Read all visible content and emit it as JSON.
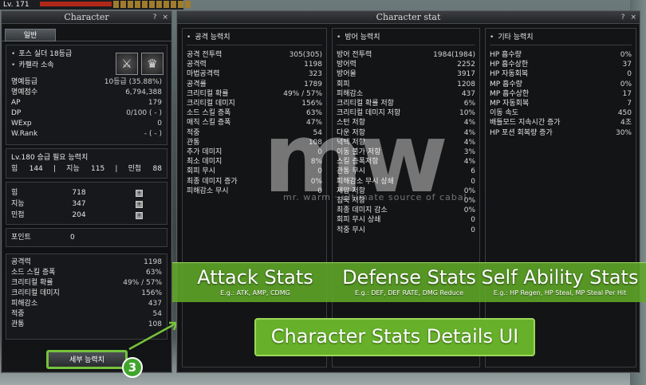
{
  "hud": {
    "level": "Lv. 171"
  },
  "character_panel": {
    "title": "Character",
    "controls": [
      "?",
      "×"
    ],
    "tab": "일반",
    "force": "포스 실더 18등급",
    "affiliation": "카펠라 소속",
    "honor": [
      {
        "k": "명예등급",
        "v": "10등급 (35.88%)"
      },
      {
        "k": "명예점수",
        "v": "6,794,388"
      },
      {
        "k": "AP",
        "v": "179"
      },
      {
        "k": "DP",
        "v": "0/100 ( - )"
      },
      {
        "k": "WExp",
        "v": "0"
      },
      {
        "k": "W.Rank",
        "v": "-   (   -   )"
      }
    ],
    "req_title": "Lv.180 승급 필요 능력치",
    "req": [
      {
        "k": "힘",
        "v": "144"
      },
      {
        "k": "지능",
        "v": "115"
      },
      {
        "k": "민첩",
        "v": "88"
      }
    ],
    "base_stats": [
      {
        "k": "힘",
        "v": "718"
      },
      {
        "k": "지능",
        "v": "347"
      },
      {
        "k": "민첩",
        "v": "204"
      }
    ],
    "points": {
      "k": "포인트",
      "v": "0"
    },
    "summary": [
      {
        "k": "공격력",
        "v": "1198"
      },
      {
        "k": "소드 스킬 증폭",
        "v": "63%"
      },
      {
        "k": "크리티컬 확률",
        "v": "49% / 57%"
      },
      {
        "k": "크리티컬 데미지",
        "v": "156%"
      },
      {
        "k": "피해감소",
        "v": "437"
      },
      {
        "k": "적중",
        "v": "54"
      },
      {
        "k": "관통",
        "v": "108"
      }
    ],
    "detail_button": "세부 능력치",
    "step_badge": "3"
  },
  "stat_panel": {
    "title": "Character stat",
    "controls": [
      "?",
      "×"
    ],
    "attack": {
      "title": "공격 능력치",
      "rows": [
        {
          "k": "공격 전투력",
          "v": "305(305)"
        },
        {
          "k": "공격력",
          "v": "1198"
        },
        {
          "k": "마법공격력",
          "v": "323"
        },
        {
          "k": "공격률",
          "v": "1789"
        },
        {
          "k": "크리티컬 확률",
          "v": "49% / 57%"
        },
        {
          "k": "크리티컬 데미지",
          "v": "156%"
        },
        {
          "k": "소드 스킬 증폭",
          "v": "63%"
        },
        {
          "k": "매직 스킬 증폭",
          "v": "47%"
        },
        {
          "k": "적중",
          "v": "54"
        },
        {
          "k": "관통",
          "v": "108"
        },
        {
          "k": "추가 데미지",
          "v": "0"
        },
        {
          "k": "최소 데미지",
          "v": "8%"
        },
        {
          "k": "회피 무시",
          "v": "0"
        },
        {
          "k": "최종 데미지 증가",
          "v": "0%"
        },
        {
          "k": "피해감소 무시",
          "v": "0"
        }
      ]
    },
    "defense": {
      "title": "방어 능력치",
      "rows": [
        {
          "k": "방어 전투력",
          "v": "1984(1984)"
        },
        {
          "k": "방어력",
          "v": "2252"
        },
        {
          "k": "방어율",
          "v": "3917"
        },
        {
          "k": "회피",
          "v": "1208"
        },
        {
          "k": "피해감소",
          "v": "437"
        },
        {
          "k": "크리티컬 확률 저항",
          "v": "6%"
        },
        {
          "k": "크리티컬 데미지 저항",
          "v": "10%"
        },
        {
          "k": "스턴 저항",
          "v": "4%"
        },
        {
          "k": "다운 저항",
          "v": "4%"
        },
        {
          "k": "넉백 저항",
          "v": "4%"
        },
        {
          "k": "이동 불가 저항",
          "v": "3%"
        },
        {
          "k": "스킬 증폭저항",
          "v": "4%"
        },
        {
          "k": "관통 무시",
          "v": "6"
        },
        {
          "k": "피해감소 무시 상쇄",
          "v": "0"
        },
        {
          "k": "제압 저항",
          "v": "0%"
        },
        {
          "k": "침묵 저항",
          "v": "0%"
        },
        {
          "k": "최종 데미지 감소",
          "v": "0%"
        },
        {
          "k": "회피 무시 상쇄",
          "v": "0"
        },
        {
          "k": "적중 무시",
          "v": "0"
        }
      ]
    },
    "other": {
      "title": "기타 능력치",
      "rows": [
        {
          "k": "HP 흡수량",
          "v": "0%"
        },
        {
          "k": "HP 흡수상한",
          "v": "37"
        },
        {
          "k": "HP 자동회복",
          "v": "0"
        },
        {
          "k": "MP 흡수량",
          "v": "0%"
        },
        {
          "k": "MP 흡수상한",
          "v": "17"
        },
        {
          "k": "MP 자동회복",
          "v": "7"
        },
        {
          "k": "이동 속도",
          "v": "450"
        },
        {
          "k": "배틀모드 지속시간 증가",
          "v": "4초"
        },
        {
          "k": "HP 포션 회복량 증가",
          "v": "30%"
        }
      ]
    }
  },
  "watermark": {
    "letters": "mw",
    "text": "mr. warm · ultimate source of cabal"
  },
  "overlay": {
    "attack": {
      "title": "Attack Stats",
      "sub": "E.g.: ATK, AMP, CDMG"
    },
    "defense": {
      "title": "Defense Stats",
      "sub": "E.g.: DEF, DEF RATE, DMG Reduce"
    },
    "self": {
      "title": "Self Ability Stats",
      "sub": "E.g.: HP Regen, HP Steal, MP Steal Per Hit"
    },
    "banner": "Character Stats Details UI"
  },
  "colors": {
    "accent_green": "#67b12a",
    "panel_bg": "#0e0f11"
  }
}
